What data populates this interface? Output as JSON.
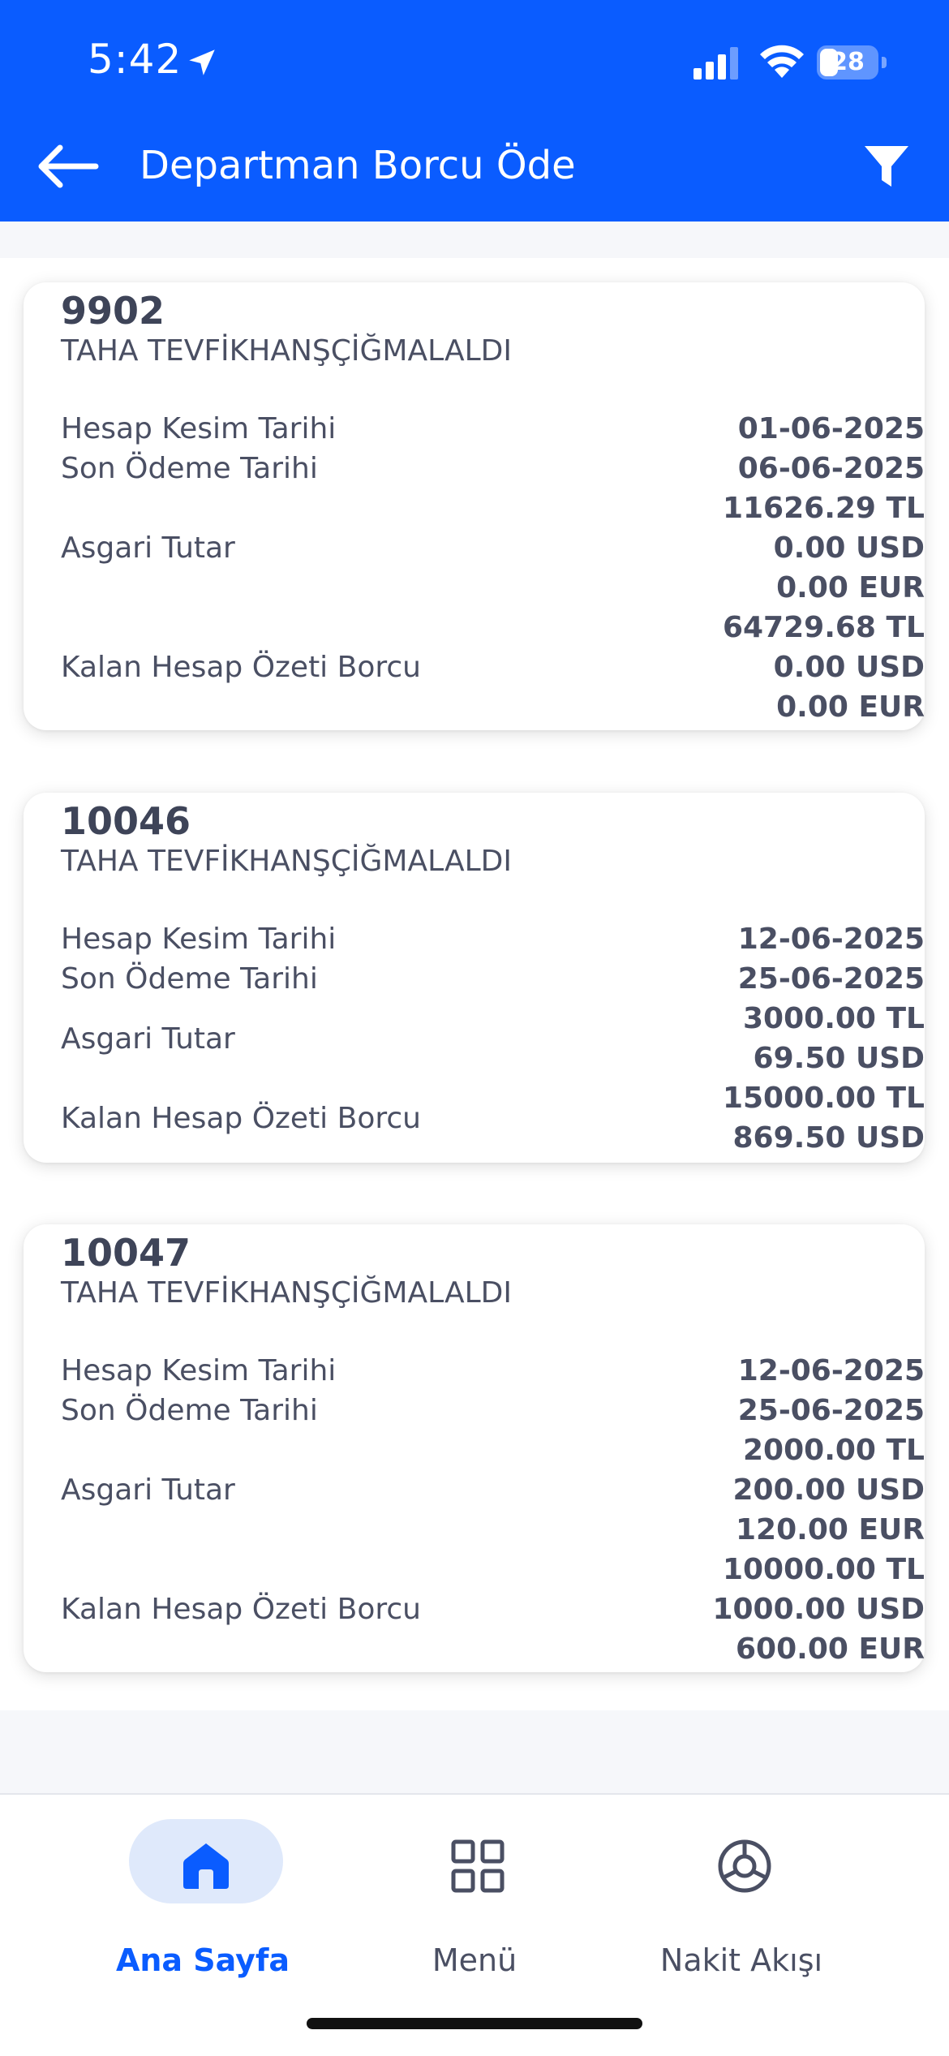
{
  "status_bar": {
    "time": "5:42",
    "battery": "28"
  },
  "header": {
    "title": "Departman Borcu Öde"
  },
  "cards": [
    {
      "id": "9902",
      "name": "TAHA TEVFİKHANŞÇİĞMALALDI",
      "labels": {
        "cut_date": "Hesap Kesim Tarihi",
        "due_date": "Son Ödeme Tarihi",
        "min_amount": "Asgari Tutar",
        "remaining": "Kalan Hesap Özeti Borcu"
      },
      "cut_date": "01-06-2025",
      "due_date": "06-06-2025",
      "min_amount": [
        "11626.29 TL",
        "0.00 USD",
        "0.00 EUR"
      ],
      "remaining": [
        "64729.68 TL",
        "0.00 USD",
        "0.00 EUR"
      ]
    },
    {
      "id": "10046",
      "name": "TAHA TEVFİKHANŞÇİĞMALALDI",
      "labels": {
        "cut_date": "Hesap Kesim Tarihi",
        "due_date": "Son Ödeme Tarihi",
        "min_amount": "Asgari Tutar",
        "remaining": "Kalan Hesap Özeti Borcu"
      },
      "cut_date": "12-06-2025",
      "due_date": "25-06-2025",
      "min_amount": [
        "3000.00 TL",
        "69.50 USD"
      ],
      "remaining": [
        "15000.00 TL",
        "869.50 USD"
      ]
    },
    {
      "id": "10047",
      "name": "TAHA TEVFİKHANŞÇİĞMALALDI",
      "labels": {
        "cut_date": "Hesap Kesim Tarihi",
        "due_date": "Son Ödeme Tarihi",
        "min_amount": "Asgari Tutar",
        "remaining": "Kalan Hesap Özeti Borcu"
      },
      "cut_date": "12-06-2025",
      "due_date": "25-06-2025",
      "min_amount": [
        "2000.00 TL",
        "200.00 USD",
        "120.00 EUR"
      ],
      "remaining": [
        "10000.00 TL",
        "1000.00 USD",
        "600.00 EUR"
      ]
    }
  ],
  "bottom_nav": {
    "items": [
      {
        "label": "Ana Sayfa",
        "icon": "home-icon",
        "active": true
      },
      {
        "label": "Menü",
        "icon": "grid-icon",
        "active": false
      },
      {
        "label": "Nakit Akışı",
        "icon": "cash-flow-icon",
        "active": false
      }
    ]
  },
  "colors": {
    "accent": "#0a5cff",
    "text": "#4a4f63",
    "pill": "#dfe9fb"
  }
}
